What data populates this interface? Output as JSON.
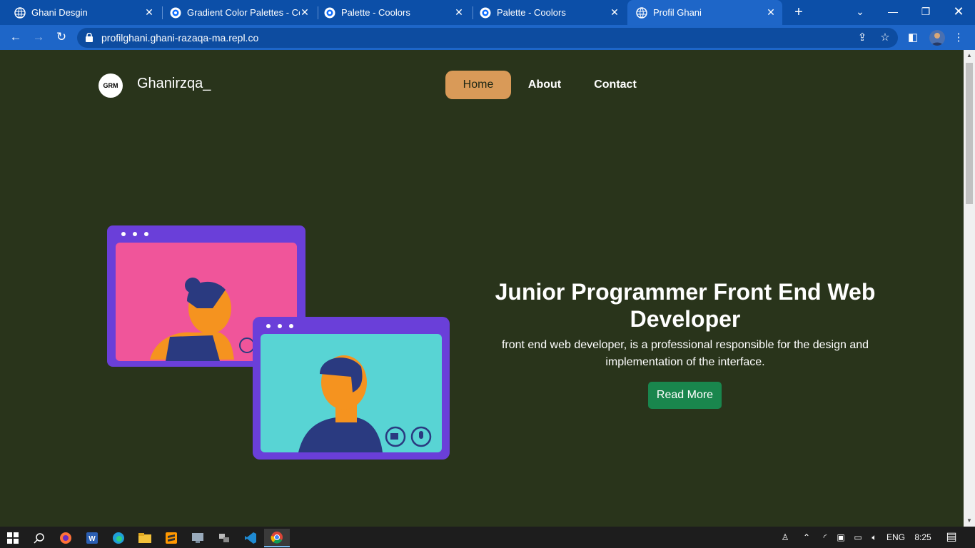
{
  "browser": {
    "tabs": [
      {
        "title": "Ghani Desgin",
        "icon": "globe-icon"
      },
      {
        "title": "Gradient Color Palettes - Coolors",
        "icon": "coolors-icon"
      },
      {
        "title": "Palette - Coolors",
        "icon": "coolors-icon"
      },
      {
        "title": "Palette - Coolors",
        "icon": "coolors-icon"
      },
      {
        "title": "Profil Ghani",
        "icon": "globe-icon",
        "active": true
      }
    ],
    "url": "profilghani.ghani-razaqa-ma.repl.co"
  },
  "site": {
    "logo_text": "GRM",
    "brand": "Ghanirzqa_",
    "nav": [
      "Home",
      "About",
      "Contact"
    ],
    "active_nav": "Home"
  },
  "hero": {
    "title": "Junior Programmer Front End Web Developer",
    "subtitle": "front end web developer, is a professional responsible for the design and implementation of the interface.",
    "button": "Read More",
    "illustration": "video-call-illustration"
  },
  "taskbar": {
    "apps": [
      "start-icon",
      "search-icon",
      "firefox-icon",
      "word-icon",
      "edge-icon",
      "file-explorer-icon",
      "sublime-text-icon",
      "remote-desktop-icon",
      "network-tool-icon",
      "vscode-icon",
      "chrome-icon"
    ],
    "language": "ENG",
    "time": "8:25"
  },
  "colors": {
    "page_bg": "#29341b",
    "home_pill": "#d99a58",
    "read_more": "#19864d",
    "chrome_blue": "#1e66c8"
  }
}
